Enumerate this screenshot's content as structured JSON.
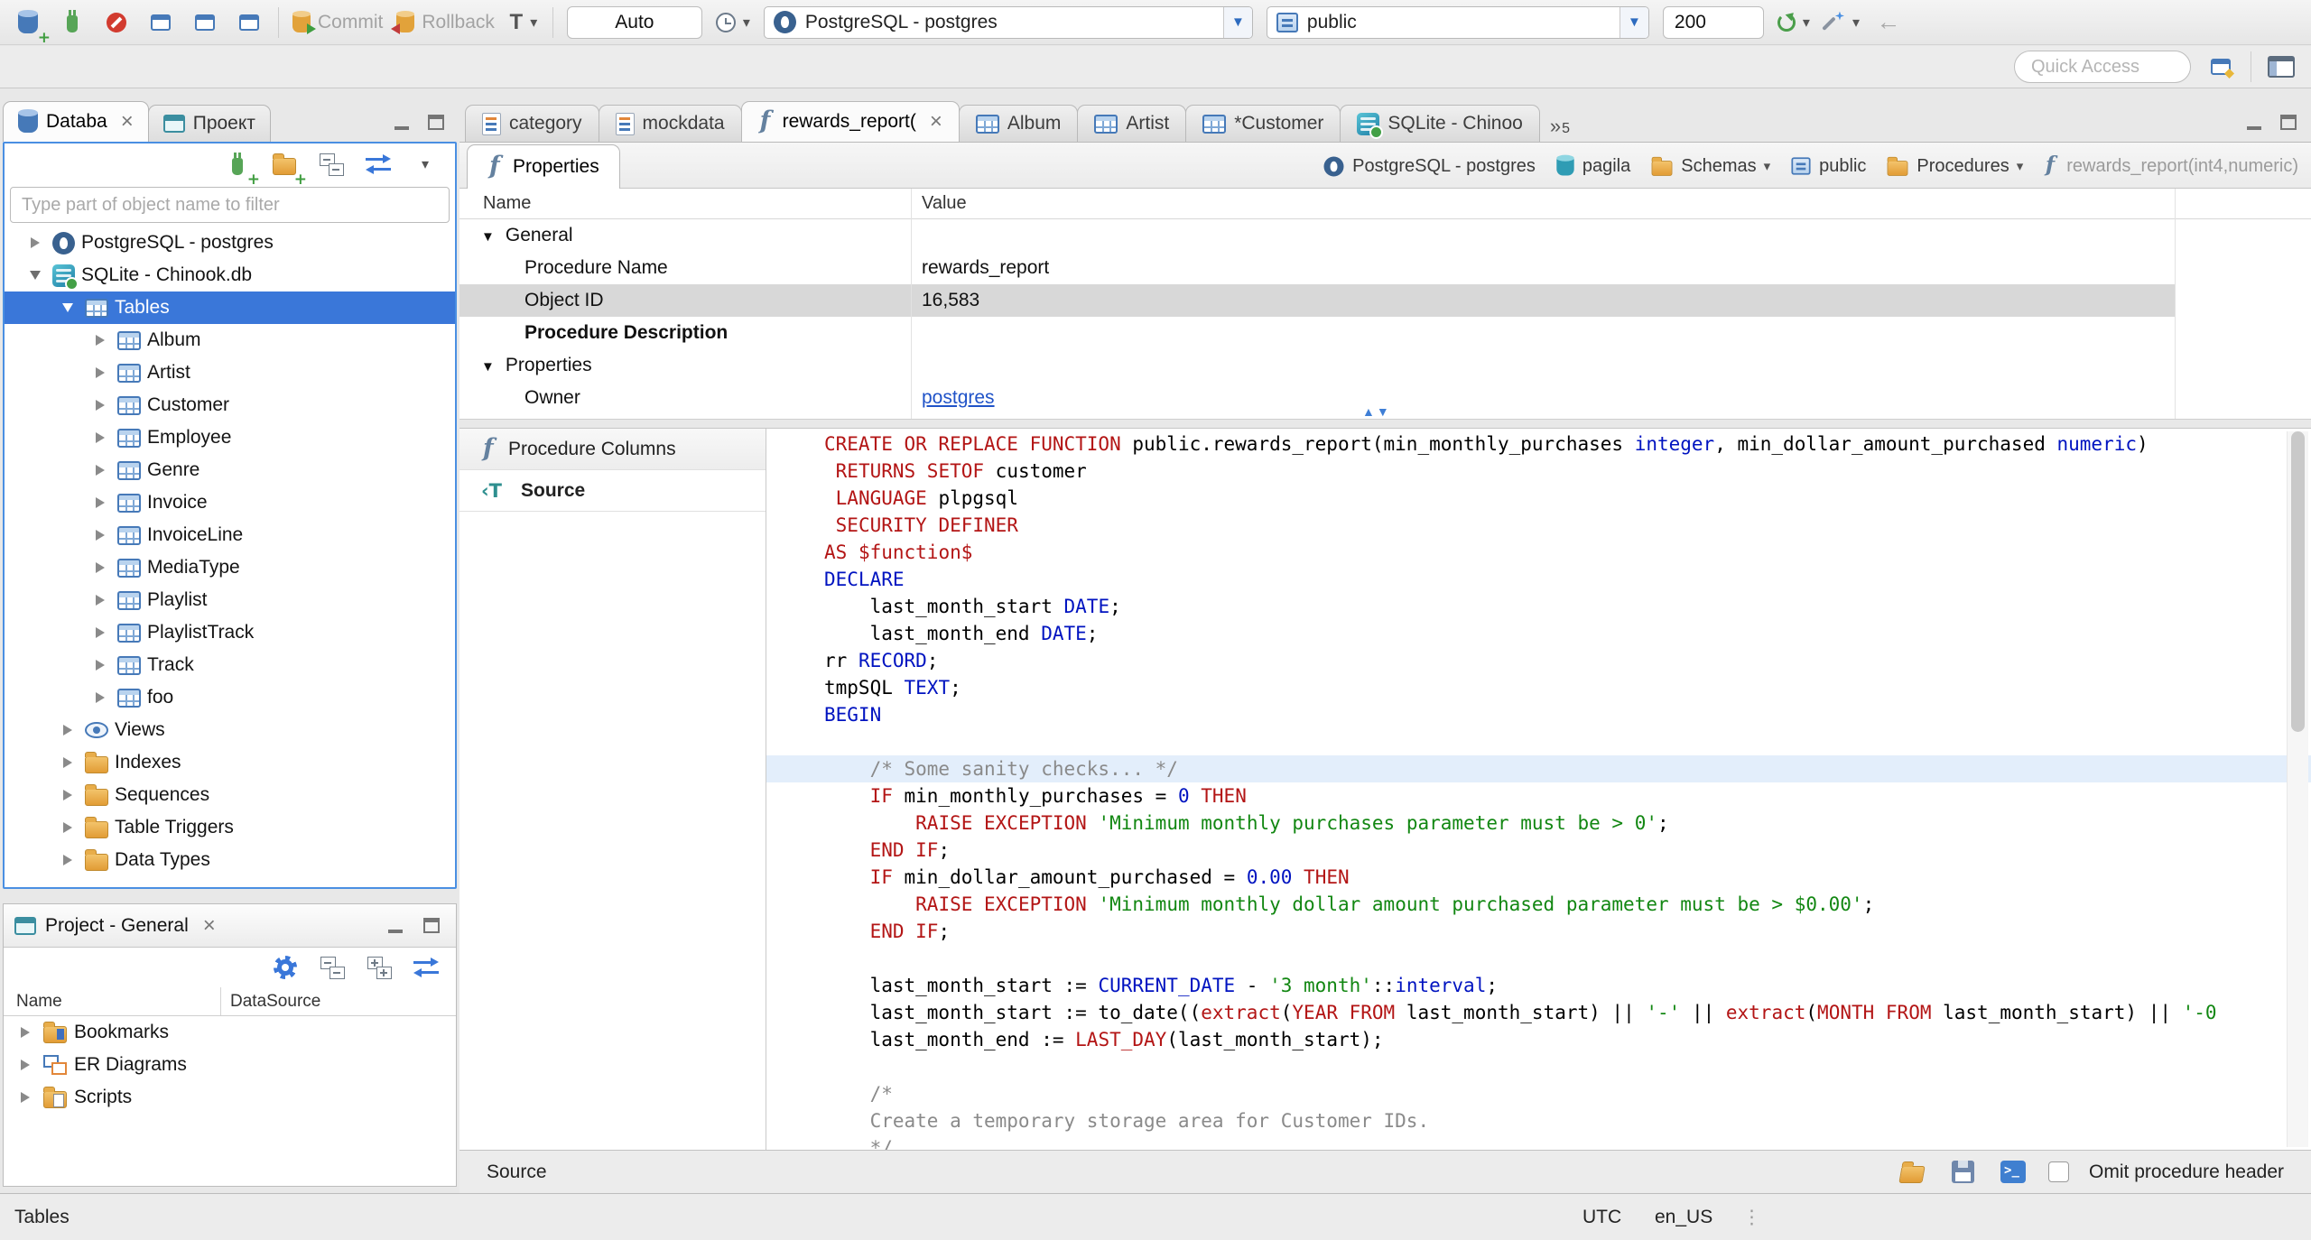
{
  "colors": {
    "selection_blue": "#3a77d9",
    "focus_border": "#4a8fe2",
    "keyword_red": "#b31515",
    "type_blue": "#0013c0",
    "string_green": "#128712",
    "comment_gray": "#8a8a8a",
    "link_blue": "#2053c8",
    "line_highlight": "#e3eefb"
  },
  "toolbar": {
    "buttons_row1": [
      "new-connection",
      "connect",
      "disconnect",
      "new-sql-editor",
      "open-sql-editor",
      "new-sql-console",
      "commit",
      "rollback",
      "transaction-mode",
      "auto-commit",
      "transaction-log",
      "active-connection",
      "active-schema",
      "fetch-size",
      "refresh-rows",
      "generate-sql",
      "undo"
    ],
    "buttons_row2": [
      "quick-access",
      "open-perspective",
      "perspective"
    ],
    "commit_label": "Commit",
    "rollback_label": "Rollback",
    "tx_mode_label": "T",
    "auto_label": "Auto",
    "connection_value": "PostgreSQL - postgres",
    "schema_value": "public",
    "fetch_size_value": "200",
    "quick_access_placeholder": "Quick Access"
  },
  "navigator": {
    "tab_database": "Databa",
    "tab_projects": "Проект",
    "filter_placeholder": "Type part of object name to filter",
    "tree": [
      {
        "label": "PostgreSQL - postgres",
        "icon": "postgres-db",
        "depth": 0,
        "exp": "closed"
      },
      {
        "label": "SQLite - Chinook.db",
        "icon": "sqlite-db",
        "depth": 0,
        "exp": "open"
      },
      {
        "label": "Tables",
        "icon": "tables",
        "depth": 1,
        "exp": "open",
        "selected": true
      },
      {
        "label": "Album",
        "icon": "table",
        "depth": 2,
        "exp": "closed"
      },
      {
        "label": "Artist",
        "icon": "table",
        "depth": 2,
        "exp": "closed"
      },
      {
        "label": "Customer",
        "icon": "table",
        "depth": 2,
        "exp": "closed"
      },
      {
        "label": "Employee",
        "icon": "table",
        "depth": 2,
        "exp": "closed"
      },
      {
        "label": "Genre",
        "icon": "table",
        "depth": 2,
        "exp": "closed"
      },
      {
        "label": "Invoice",
        "icon": "table",
        "depth": 2,
        "exp": "closed"
      },
      {
        "label": "InvoiceLine",
        "icon": "table",
        "depth": 2,
        "exp": "closed"
      },
      {
        "label": "MediaType",
        "icon": "table",
        "depth": 2,
        "exp": "closed"
      },
      {
        "label": "Playlist",
        "icon": "table",
        "depth": 2,
        "exp": "closed"
      },
      {
        "label": "PlaylistTrack",
        "icon": "table",
        "depth": 2,
        "exp": "closed"
      },
      {
        "label": "Track",
        "icon": "table",
        "depth": 2,
        "exp": "closed"
      },
      {
        "label": "foo",
        "icon": "table",
        "depth": 2,
        "exp": "closed"
      },
      {
        "label": "Views",
        "icon": "views",
        "depth": 1,
        "exp": "closed"
      },
      {
        "label": "Indexes",
        "icon": "folder",
        "depth": 1,
        "exp": "closed"
      },
      {
        "label": "Sequences",
        "icon": "folder",
        "depth": 1,
        "exp": "closed"
      },
      {
        "label": "Table Triggers",
        "icon": "folder",
        "depth": 1,
        "exp": "closed"
      },
      {
        "label": "Data Types",
        "icon": "folder",
        "depth": 1,
        "exp": "closed"
      }
    ]
  },
  "project_panel": {
    "title": "Project - General",
    "col_name": "Name",
    "col_datasource": "DataSource",
    "items": [
      {
        "label": "Bookmarks",
        "icon": "bookmarks-folder"
      },
      {
        "label": "ER Diagrams",
        "icon": "er-diagrams"
      },
      {
        "label": "Scripts",
        "icon": "scripts-folder"
      }
    ]
  },
  "editor_tabs": [
    {
      "label": "category",
      "icon": "sql-script"
    },
    {
      "label": "mockdata",
      "icon": "sql-script"
    },
    {
      "label": "rewards_report(",
      "icon": "function",
      "active": true,
      "closable": true
    },
    {
      "label": "Album",
      "icon": "table"
    },
    {
      "label": "Artist",
      "icon": "table"
    },
    {
      "label": "*Customer",
      "icon": "table"
    },
    {
      "label": "SQLite - Chinoo",
      "icon": "sqlite-db"
    }
  ],
  "editor_tab_overflow": "5",
  "properties_view": {
    "tab_label": "Properties",
    "breadcrumb": [
      {
        "label": "PostgreSQL - postgres",
        "icon": "postgres-db"
      },
      {
        "label": "pagila",
        "icon": "database"
      },
      {
        "label": "Schemas",
        "icon": "schemas-folder",
        "dropdown": true
      },
      {
        "label": "public",
        "icon": "schema"
      },
      {
        "label": "Procedures",
        "icon": "procedures-folder",
        "dropdown": true
      },
      {
        "label": "rewards_report(int4,numeric)",
        "icon": "function",
        "dim": true
      }
    ],
    "grid": {
      "col_name": "Name",
      "col_value": "Value",
      "rows": [
        {
          "name": "General",
          "group": true,
          "expanded": true
        },
        {
          "name": "Procedure Name",
          "value": "rewards_report"
        },
        {
          "name": "Object ID",
          "value": "16,583",
          "selected": true
        },
        {
          "name": "Procedure Description",
          "bold": true
        },
        {
          "name": "Properties",
          "group": true,
          "expanded": true
        },
        {
          "name": "Owner",
          "value": "postgres",
          "link": true
        }
      ]
    }
  },
  "source_view": {
    "side_tabs": [
      {
        "label": "Procedure Columns",
        "icon": "function"
      },
      {
        "label": "Source",
        "icon": "source",
        "active": true
      }
    ],
    "footer_label": "Source",
    "omit_header_label": "Omit procedure header",
    "code_lines": [
      {
        "seg": [
          {
            "t": "CREATE OR REPLACE FUNCTION",
            "c": "k"
          },
          {
            "t": " public.rewards_report(min_monthly_purchases ",
            "c": "p"
          },
          {
            "t": "integer",
            "c": "b"
          },
          {
            "t": ", min_dollar_amount_purchased ",
            "c": "p"
          },
          {
            "t": "numeric",
            "c": "b"
          },
          {
            "t": ")",
            "c": "p"
          }
        ]
      },
      {
        "seg": [
          {
            "t": " ",
            "c": "p"
          },
          {
            "t": "RETURNS SETOF",
            "c": "k"
          },
          {
            "t": " customer",
            "c": "p"
          }
        ]
      },
      {
        "seg": [
          {
            "t": " ",
            "c": "p"
          },
          {
            "t": "LANGUAGE",
            "c": "k"
          },
          {
            "t": " plpgsql",
            "c": "p"
          }
        ]
      },
      {
        "seg": [
          {
            "t": " ",
            "c": "p"
          },
          {
            "t": "SECURITY DEFINER",
            "c": "k"
          }
        ]
      },
      {
        "seg": [
          {
            "t": "AS",
            "c": "k"
          },
          {
            "t": " ",
            "c": "p"
          },
          {
            "t": "$function$",
            "c": "k"
          }
        ]
      },
      {
        "seg": [
          {
            "t": "DECLARE",
            "c": "b"
          }
        ]
      },
      {
        "seg": [
          {
            "t": "    last_month_start ",
            "c": "p"
          },
          {
            "t": "DATE",
            "c": "b"
          },
          {
            "t": ";",
            "c": "p"
          }
        ]
      },
      {
        "seg": [
          {
            "t": "    last_month_end ",
            "c": "p"
          },
          {
            "t": "DATE",
            "c": "b"
          },
          {
            "t": ";",
            "c": "p"
          }
        ]
      },
      {
        "seg": [
          {
            "t": "rr ",
            "c": "p"
          },
          {
            "t": "RECORD",
            "c": "b"
          },
          {
            "t": ";",
            "c": "p"
          }
        ]
      },
      {
        "seg": [
          {
            "t": "tmpSQL ",
            "c": "p"
          },
          {
            "t": "TEXT",
            "c": "b"
          },
          {
            "t": ";",
            "c": "p"
          }
        ]
      },
      {
        "seg": [
          {
            "t": "BEGIN",
            "c": "b"
          }
        ]
      },
      {
        "seg": []
      },
      {
        "hl": true,
        "seg": [
          {
            "t": "    /* Some sanity checks... */",
            "c": "c"
          }
        ]
      },
      {
        "seg": [
          {
            "t": "    ",
            "c": "p"
          },
          {
            "t": "IF",
            "c": "k"
          },
          {
            "t": " min_monthly_purchases = ",
            "c": "p"
          },
          {
            "t": "0",
            "c": "b"
          },
          {
            "t": " ",
            "c": "p"
          },
          {
            "t": "THEN",
            "c": "k"
          }
        ]
      },
      {
        "seg": [
          {
            "t": "        ",
            "c": "p"
          },
          {
            "t": "RAISE EXCEPTION",
            "c": "k"
          },
          {
            "t": " ",
            "c": "p"
          },
          {
            "t": "'Minimum monthly purchases parameter must be > 0'",
            "c": "s"
          },
          {
            "t": ";",
            "c": "p"
          }
        ]
      },
      {
        "seg": [
          {
            "t": "    ",
            "c": "p"
          },
          {
            "t": "END IF",
            "c": "k"
          },
          {
            "t": ";",
            "c": "p"
          }
        ]
      },
      {
        "seg": [
          {
            "t": "    ",
            "c": "p"
          },
          {
            "t": "IF",
            "c": "k"
          },
          {
            "t": " min_dollar_amount_purchased = ",
            "c": "p"
          },
          {
            "t": "0.00",
            "c": "b"
          },
          {
            "t": " ",
            "c": "p"
          },
          {
            "t": "THEN",
            "c": "k"
          }
        ]
      },
      {
        "seg": [
          {
            "t": "        ",
            "c": "p"
          },
          {
            "t": "RAISE EXCEPTION",
            "c": "k"
          },
          {
            "t": " ",
            "c": "p"
          },
          {
            "t": "'Minimum monthly dollar amount purchased parameter must be > $0.00'",
            "c": "s"
          },
          {
            "t": ";",
            "c": "p"
          }
        ]
      },
      {
        "seg": [
          {
            "t": "    ",
            "c": "p"
          },
          {
            "t": "END IF",
            "c": "k"
          },
          {
            "t": ";",
            "c": "p"
          }
        ]
      },
      {
        "seg": []
      },
      {
        "seg": [
          {
            "t": "    last_month_start := ",
            "c": "p"
          },
          {
            "t": "CURRENT_DATE",
            "c": "b"
          },
          {
            "t": " - ",
            "c": "p"
          },
          {
            "t": "'3 month'",
            "c": "s"
          },
          {
            "t": "::",
            "c": "p"
          },
          {
            "t": "interval",
            "c": "b"
          },
          {
            "t": ";",
            "c": "p"
          }
        ]
      },
      {
        "seg": [
          {
            "t": "    last_month_start := to_date((",
            "c": "p"
          },
          {
            "t": "extract",
            "c": "k"
          },
          {
            "t": "(",
            "c": "p"
          },
          {
            "t": "YEAR FROM",
            "c": "k"
          },
          {
            "t": " last_month_start) || ",
            "c": "p"
          },
          {
            "t": "'-'",
            "c": "s"
          },
          {
            "t": " || ",
            "c": "p"
          },
          {
            "t": "extract",
            "c": "k"
          },
          {
            "t": "(",
            "c": "p"
          },
          {
            "t": "MONTH FROM",
            "c": "k"
          },
          {
            "t": " last_month_start) || ",
            "c": "p"
          },
          {
            "t": "'-0",
            "c": "s"
          }
        ]
      },
      {
        "seg": [
          {
            "t": "    last_month_end := ",
            "c": "p"
          },
          {
            "t": "LAST_DAY",
            "c": "k"
          },
          {
            "t": "(last_month_start);",
            "c": "p"
          }
        ]
      },
      {
        "seg": []
      },
      {
        "seg": [
          {
            "t": "    /*",
            "c": "c"
          }
        ]
      },
      {
        "seg": [
          {
            "t": "    Create a temporary storage area for Customer IDs.",
            "c": "c"
          }
        ]
      },
      {
        "seg": [
          {
            "t": "    */",
            "c": "c"
          }
        ]
      }
    ]
  },
  "status_bar": {
    "left": "Tables",
    "timezone": "UTC",
    "locale": "en_US"
  }
}
